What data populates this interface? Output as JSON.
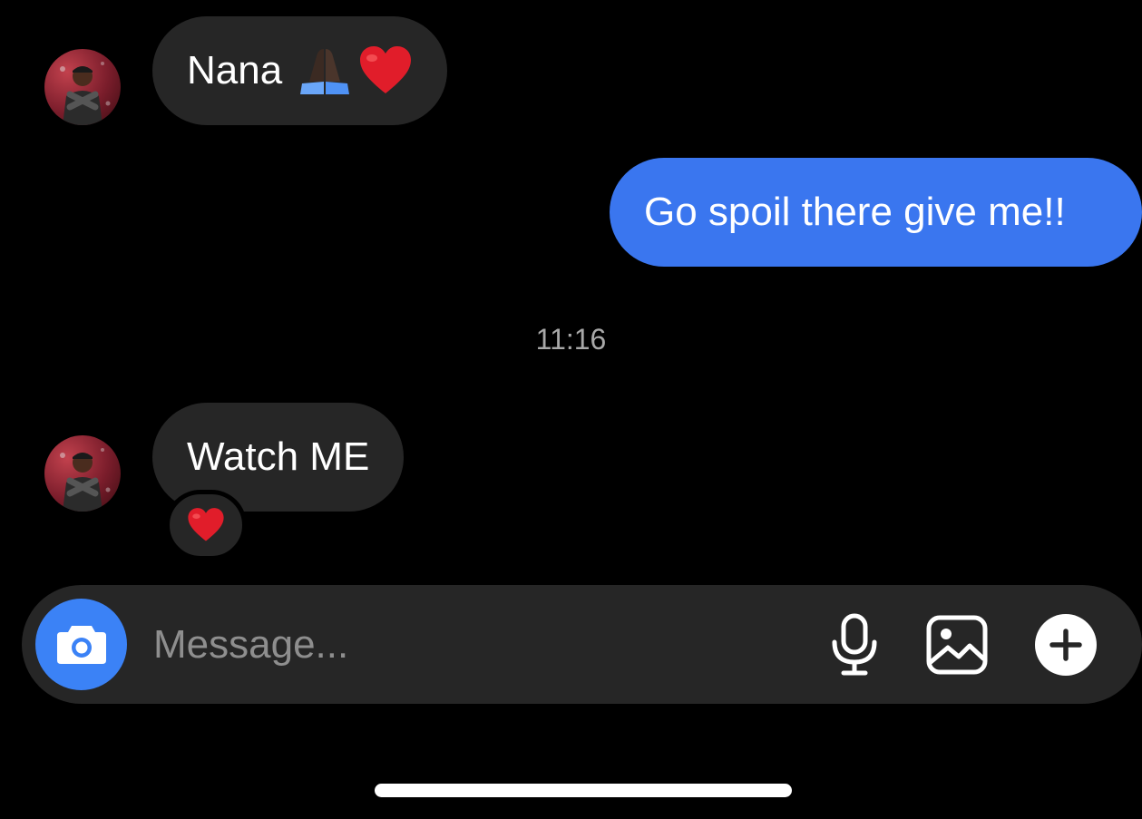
{
  "conversation": {
    "messages": [
      {
        "direction": "received",
        "text": "Nana",
        "emoji": [
          "folded-hands",
          "red-heart"
        ]
      },
      {
        "direction": "sent",
        "text": "Go spoil there give me!!"
      },
      {
        "direction": "received",
        "text": "Watch ME",
        "reaction": "red-heart"
      }
    ],
    "timestamp": "11:16"
  },
  "composer": {
    "placeholder": "Message...",
    "value": "",
    "buttons": [
      "camera-icon",
      "microphone-icon",
      "image-icon",
      "plus-icon"
    ]
  },
  "colors": {
    "background": "#000000",
    "received_bubble": "#262626",
    "sent_bubble": "#3a76ef",
    "accent": "#3b82f6",
    "timestamp": "#a8a8a8",
    "placeholder": "#8e8e8e"
  }
}
